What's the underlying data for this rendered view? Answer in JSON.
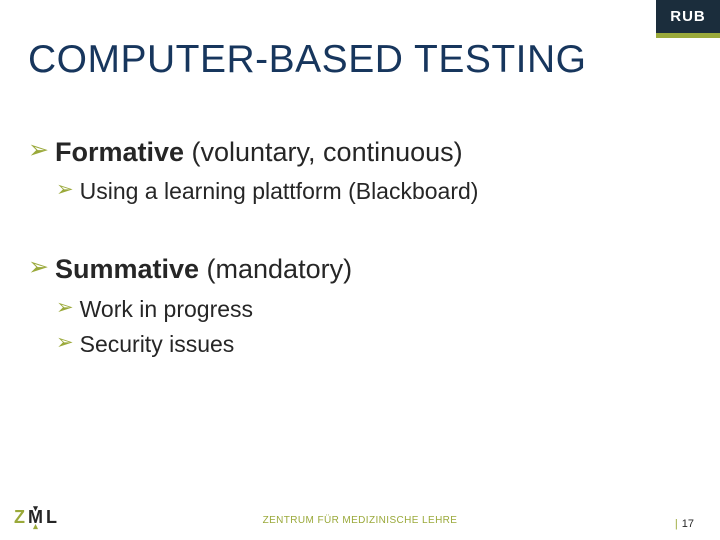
{
  "brand": "RUB",
  "title": "COMPUTER-BASED TESTING",
  "bullets": [
    {
      "level": 1,
      "strong": "Formative",
      "rest": " (voluntary, continuous)"
    },
    {
      "level": 2,
      "text": "Using a learning plattform (Blackboard)"
    },
    {
      "level": "gap"
    },
    {
      "level": 1,
      "strong": "Summative",
      "rest": " (mandatory)"
    },
    {
      "level": 2,
      "text": "Work in progress"
    },
    {
      "level": 2,
      "text": "Security issues"
    }
  ],
  "footer_center": "ZENTRUM FÜR MEDIZINISCHE LEHRE",
  "logo": {
    "z": "Z",
    "m": "M",
    "l": "L"
  },
  "page": {
    "sep": "|",
    "num": "17"
  }
}
